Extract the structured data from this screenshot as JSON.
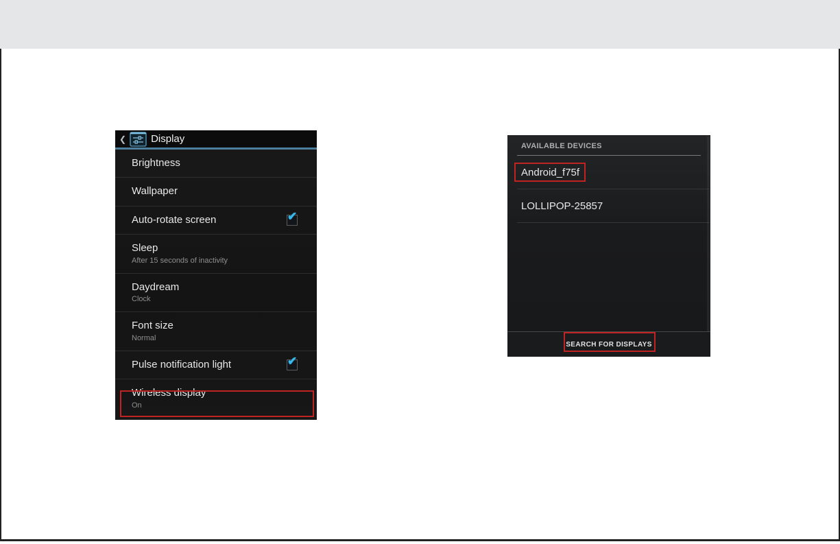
{
  "display_panel": {
    "title": "Display",
    "items": [
      {
        "label": "Brightness"
      },
      {
        "label": "Wallpaper"
      },
      {
        "label": "Auto-rotate screen",
        "checked": true
      },
      {
        "label": "Sleep",
        "sublabel": "After 15 seconds of inactivity"
      },
      {
        "label": "Daydream",
        "sublabel": "Clock"
      },
      {
        "label": "Font size",
        "sublabel": "Normal"
      },
      {
        "label": "Pulse notification light",
        "checked": true
      },
      {
        "label": "Wireless display",
        "sublabel": "On",
        "highlighted": true
      }
    ]
  },
  "devices_panel": {
    "section_title": "AVAILABLE DEVICES",
    "devices": [
      {
        "name": "Android_f75f",
        "highlighted": true
      },
      {
        "name": "LOLLIPOP-25857",
        "highlighted": false
      }
    ],
    "search_button_label": "SEARCH FOR DISPLAYS"
  },
  "icons": {
    "back": "❮",
    "check": "✔"
  },
  "colors": {
    "annotation_red": "#c12222",
    "holo_check_blue": "#38b9ec",
    "header_underline_blue": "#4c7f9e",
    "top_bar_gray": "#e5e6e8"
  }
}
